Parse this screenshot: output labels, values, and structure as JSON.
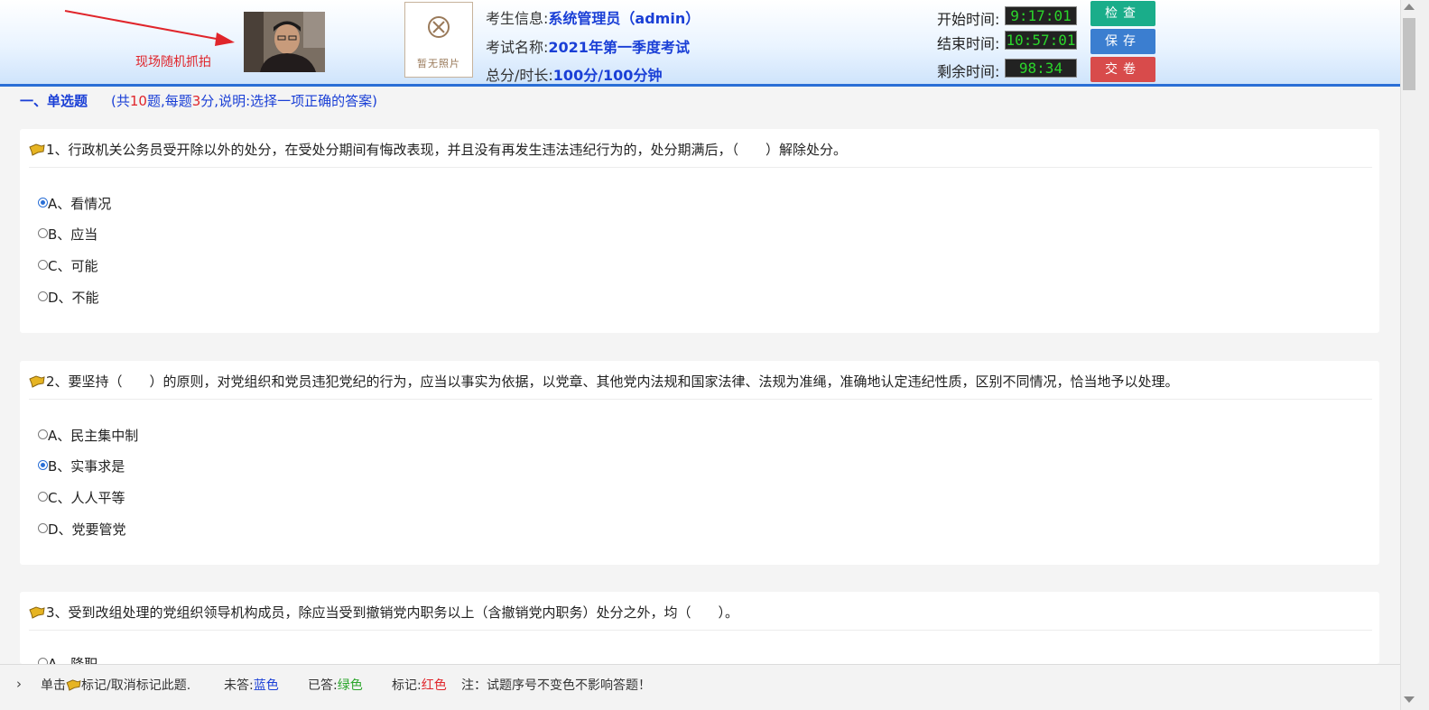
{
  "header": {
    "snap_label": "现场随机抓拍",
    "photo_placeholder": "暂无照片",
    "candidate_label": "考生信息:",
    "candidate_value": "系统管理员（admin）",
    "exam_label": "考试名称:",
    "exam_value": "2021年第一季度考试",
    "score_label": "总分/时长:",
    "score_value": "100分/100分钟",
    "start_label": "开始时间:",
    "start_value": "9:17:01",
    "end_label": "结束时间:",
    "end_value": "10:57:01",
    "remain_label": "剩余时间:",
    "remain_value": "98:34",
    "btn_check": "检查",
    "btn_save": "保存",
    "btn_submit": "交卷"
  },
  "section": {
    "name": "一、单选题",
    "desc_prefix": "(共",
    "count": "10",
    "desc_mid": "题,每题",
    "points": "3",
    "desc_suffix": "分,说明:选择一项正确的答案)"
  },
  "questions": [
    {
      "title": "1、行政机关公务员受开除以外的处分，在受处分期间有悔改表现，并且没有再发生违法违纪行为的，处分期满后，（　　）解除处分。",
      "options": [
        "A、看情况",
        "B、应当",
        "C、可能",
        "D、不能"
      ],
      "selected": 0
    },
    {
      "title": "2、要坚持（　　）的原则，对党组织和党员违犯党纪的行为，应当以事实为依据，以党章、其他党内法规和国家法律、法规为准绳，准确地认定违纪性质，区别不同情况，恰当地予以处理。",
      "options": [
        "A、民主集中制",
        "B、实事求是",
        "C、人人平等",
        "D、党要管党"
      ],
      "selected": 1
    },
    {
      "title": "3、受到改组处理的党组织领导机构成员，除应当受到撤销党内职务以上（含撤销党内职务）处分之外，均（　　）。",
      "options": [
        "A、降职"
      ],
      "selected": -1
    }
  ],
  "bottombar": {
    "click_prefix": "单击",
    "click_suffix": "标记/取消标记此题.",
    "unanswered_label": "未答:",
    "unanswered_value": "蓝色",
    "answered_label": "已答:",
    "answered_value": "绿色",
    "marked_label": "标记:",
    "marked_value": "红色",
    "note": "注：试题序号不变色不影响答题！"
  },
  "colors": {
    "accent_blue": "#1a3fd6",
    "answered_green": "#2ba52b",
    "marked_red": "#e0252b",
    "check_button": "#1aad8a",
    "save_button": "#3b7ed0",
    "submit_button": "#d84b4b"
  }
}
